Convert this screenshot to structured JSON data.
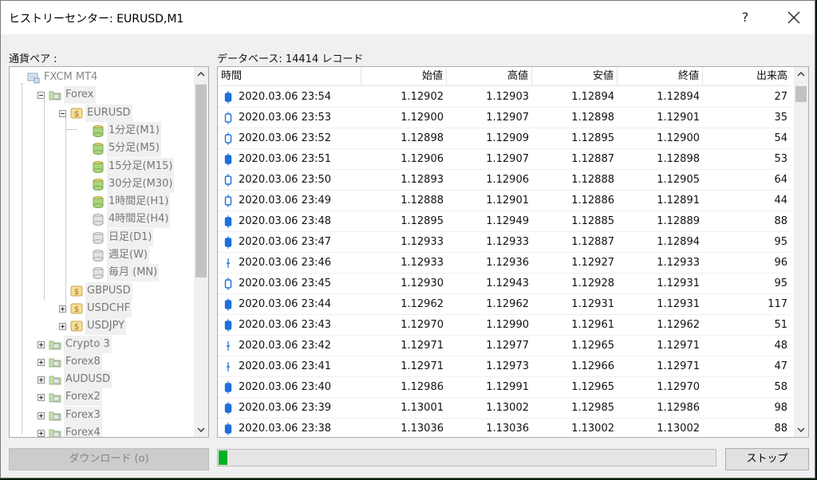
{
  "window": {
    "title": "ヒストリーセンター: EURUSD,M1",
    "help_label": "?"
  },
  "pair_label": "通貨ペア :",
  "db_label": "データベース: 14414 レコード",
  "tree": {
    "root": "FXCM MT4",
    "forex": "Forex",
    "eurusd": "EURUSD",
    "timeframes": [
      "1分足(M1)",
      "5分足(M5)",
      "15分足(M15)",
      "30分足(M30)",
      "1時間足(H1)",
      "4時間足(H4)",
      "日足(D1)",
      "週足(W)",
      "毎月 (MN)"
    ],
    "pairs": [
      "GBPUSD",
      "USDCHF",
      "USDJPY"
    ],
    "groups": [
      "Crypto 3",
      "Forex8",
      "AUDUSD",
      "Forex2",
      "Forex3",
      "Forex4"
    ]
  },
  "table": {
    "headers": [
      "時間",
      "始値",
      "高値",
      "安値",
      "終値",
      "出来高"
    ],
    "rows": [
      [
        "2020.03.06 23:54",
        "1.12902",
        "1.12903",
        "1.12894",
        "1.12894",
        "27"
      ],
      [
        "2020.03.06 23:53",
        "1.12900",
        "1.12907",
        "1.12898",
        "1.12901",
        "35"
      ],
      [
        "2020.03.06 23:52",
        "1.12898",
        "1.12909",
        "1.12895",
        "1.12900",
        "54"
      ],
      [
        "2020.03.06 23:51",
        "1.12906",
        "1.12907",
        "1.12887",
        "1.12898",
        "53"
      ],
      [
        "2020.03.06 23:50",
        "1.12893",
        "1.12906",
        "1.12888",
        "1.12905",
        "64"
      ],
      [
        "2020.03.06 23:49",
        "1.12888",
        "1.12901",
        "1.12886",
        "1.12891",
        "44"
      ],
      [
        "2020.03.06 23:48",
        "1.12895",
        "1.12949",
        "1.12885",
        "1.12889",
        "88"
      ],
      [
        "2020.03.06 23:47",
        "1.12933",
        "1.12933",
        "1.12887",
        "1.12894",
        "95"
      ],
      [
        "2020.03.06 23:46",
        "1.12933",
        "1.12936",
        "1.12927",
        "1.12933",
        "96"
      ],
      [
        "2020.03.06 23:45",
        "1.12930",
        "1.12943",
        "1.12928",
        "1.12931",
        "95"
      ],
      [
        "2020.03.06 23:44",
        "1.12962",
        "1.12962",
        "1.12931",
        "1.12931",
        "117"
      ],
      [
        "2020.03.06 23:43",
        "1.12970",
        "1.12990",
        "1.12961",
        "1.12962",
        "51"
      ],
      [
        "2020.03.06 23:42",
        "1.12971",
        "1.12977",
        "1.12965",
        "1.12971",
        "48"
      ],
      [
        "2020.03.06 23:41",
        "1.12971",
        "1.12973",
        "1.12966",
        "1.12971",
        "47"
      ],
      [
        "2020.03.06 23:40",
        "1.12986",
        "1.12991",
        "1.12965",
        "1.12970",
        "58"
      ],
      [
        "2020.03.06 23:39",
        "1.13001",
        "1.13002",
        "1.12985",
        "1.12986",
        "98"
      ],
      [
        "2020.03.06 23:38",
        "1.13036",
        "1.13036",
        "1.13002",
        "1.13002",
        "88"
      ]
    ]
  },
  "buttons": {
    "download": "ダウンロード (o)",
    "stop": "ストップ"
  },
  "progress": {
    "value": 0.017
  },
  "colors": {
    "accent": "#06b025",
    "candle": "#1e6fd9"
  },
  "icons": {
    "close": "close-icon",
    "candle": "candle-icon",
    "folder": "folder-icon",
    "coin": "coin-icon"
  }
}
